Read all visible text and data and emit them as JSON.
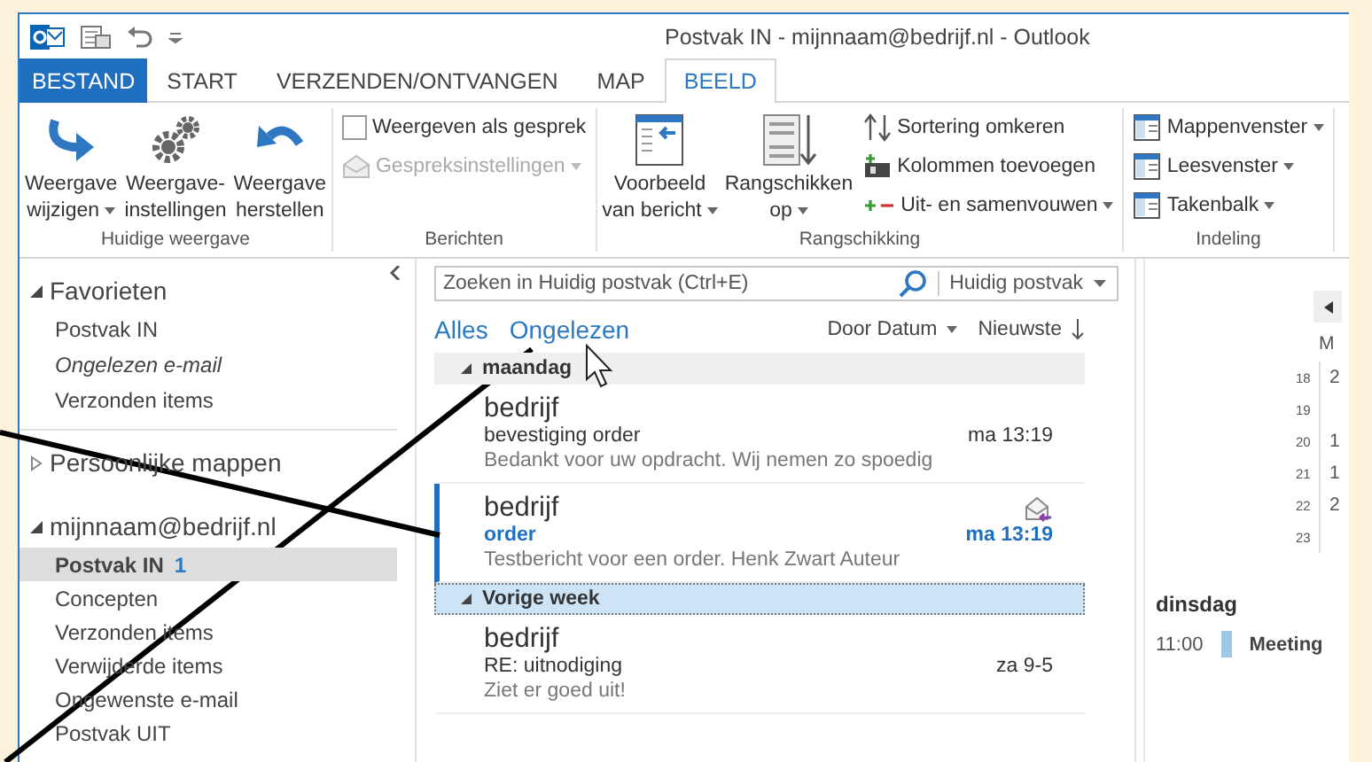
{
  "window": {
    "title": "Postvak IN - mijnnaam@bedrijf.nl - Outlook"
  },
  "tabs": [
    {
      "label": "BESTAND",
      "kind": "file",
      "selected": false
    },
    {
      "label": "START",
      "kind": "tab",
      "selected": false
    },
    {
      "label": "VERZENDEN/ONTVANGEN",
      "kind": "tab",
      "selected": false
    },
    {
      "label": "MAP",
      "kind": "tab",
      "selected": false
    },
    {
      "label": "BEELD",
      "kind": "tab",
      "selected": true
    }
  ],
  "ribbon": {
    "groups": [
      {
        "label": "Huidige weergave",
        "items": [
          {
            "kind": "large",
            "lines": [
              "Weergave",
              "wijzigen"
            ],
            "dropdown": true
          },
          {
            "kind": "large",
            "lines": [
              "Weergave-",
              "instellingen"
            ],
            "dropdown": false
          },
          {
            "kind": "large",
            "lines": [
              "Weergave",
              "herstellen"
            ],
            "dropdown": false
          }
        ]
      },
      {
        "label": "Berichten",
        "items": [
          {
            "kind": "stack",
            "entries": [
              {
                "kind": "check",
                "label": "Weergeven als gesprek",
                "checked": false
              },
              {
                "kind": "small",
                "label": "Gespreksinstellingen",
                "dropdown": true,
                "disabled": true
              }
            ]
          }
        ]
      },
      {
        "label": "Rangschikking",
        "items": [
          {
            "kind": "large",
            "lines": [
              "Voorbeeld",
              "van bericht"
            ],
            "dropdown": true
          },
          {
            "kind": "large",
            "lines": [
              "Rangschikken",
              "op"
            ],
            "dropdown": true
          },
          {
            "kind": "stack",
            "entries": [
              {
                "kind": "small",
                "label": "Sortering omkeren",
                "dropdown": false,
                "disabled": false
              },
              {
                "kind": "small",
                "label": "Kolommen toevoegen",
                "dropdown": false,
                "disabled": false
              },
              {
                "kind": "small",
                "label": "Uit- en samenvouwen",
                "dropdown": true,
                "disabled": false
              }
            ]
          }
        ]
      },
      {
        "label": "Indeling",
        "items": [
          {
            "kind": "stack",
            "entries": [
              {
                "kind": "small",
                "label": "Mappenvenster",
                "dropdown": true,
                "disabled": false
              },
              {
                "kind": "small",
                "label": "Leesvenster",
                "dropdown": true,
                "disabled": false
              },
              {
                "kind": "small",
                "label": "Takenbalk",
                "dropdown": true,
                "disabled": false
              }
            ]
          }
        ]
      }
    ]
  },
  "folder_pane": {
    "sections": [
      {
        "label": "Favorieten",
        "expanded": true,
        "items": [
          {
            "label": "Postvak IN",
            "kind": "folder",
            "selected": false
          },
          {
            "label": "Ongelezen e-mail",
            "kind": "search",
            "selected": false
          },
          {
            "label": "Verzonden items",
            "kind": "folder",
            "selected": false
          }
        ]
      },
      {
        "label": "Persoonlijke mappen",
        "expanded": false
      },
      {
        "label": "mijnnaam@bedrijf.nl",
        "expanded": true,
        "items": [
          {
            "label": "Postvak IN",
            "kind": "folder",
            "selected": true,
            "count": "1"
          },
          {
            "label": "Concepten",
            "kind": "folder",
            "selected": false
          },
          {
            "label": "Verzonden items",
            "kind": "folder",
            "selected": false
          },
          {
            "label": "Verwijderde items",
            "kind": "folder",
            "selected": false
          },
          {
            "label": "Ongewenste e-mail",
            "kind": "folder",
            "selected": false
          },
          {
            "label": "Postvak UIT",
            "kind": "folder",
            "selected": false
          }
        ]
      }
    ]
  },
  "message_list": {
    "search": {
      "placeholder": "Zoeken in Huidig postvak (Ctrl+E)",
      "scope": "Huidig postvak"
    },
    "filters": [
      "Alles",
      "Ongelezen"
    ],
    "sort": {
      "field": "Door Datum",
      "order": "Nieuwste"
    },
    "groups": [
      {
        "label": "maandag",
        "selected": false,
        "messages": [
          {
            "sender": "bedrijf",
            "subject": "bevestiging order",
            "time": "ma 13:19",
            "preview": "Bedankt voor uw opdracht. Wij nemen zo spoedig",
            "unread": false,
            "replied": false
          },
          {
            "sender": "bedrijf",
            "subject": "order",
            "time": "ma 13:19",
            "preview": "Testbericht voor een order.  Henk Zwart  Auteur",
            "unread": true,
            "replied": true
          }
        ]
      },
      {
        "label": "Vorige week",
        "selected": true,
        "messages": [
          {
            "sender": "bedrijf",
            "subject": "RE: uitnodiging",
            "time": "za 9-5",
            "preview": "Ziet er goed uit!",
            "unread": false,
            "replied": false
          }
        ]
      }
    ]
  },
  "todo_bar": {
    "calendar": {
      "header": "M",
      "weeks": [
        {
          "week": "18",
          "day": "2"
        },
        {
          "week": "19"
        },
        {
          "week": "20",
          "day": "1"
        },
        {
          "week": "21",
          "day": "1"
        },
        {
          "week": "22",
          "day": "2"
        },
        {
          "week": "23"
        }
      ]
    },
    "appointments": {
      "day": "dinsdag",
      "items": [
        {
          "time": "11:00",
          "title": "Meeting"
        }
      ]
    }
  }
}
